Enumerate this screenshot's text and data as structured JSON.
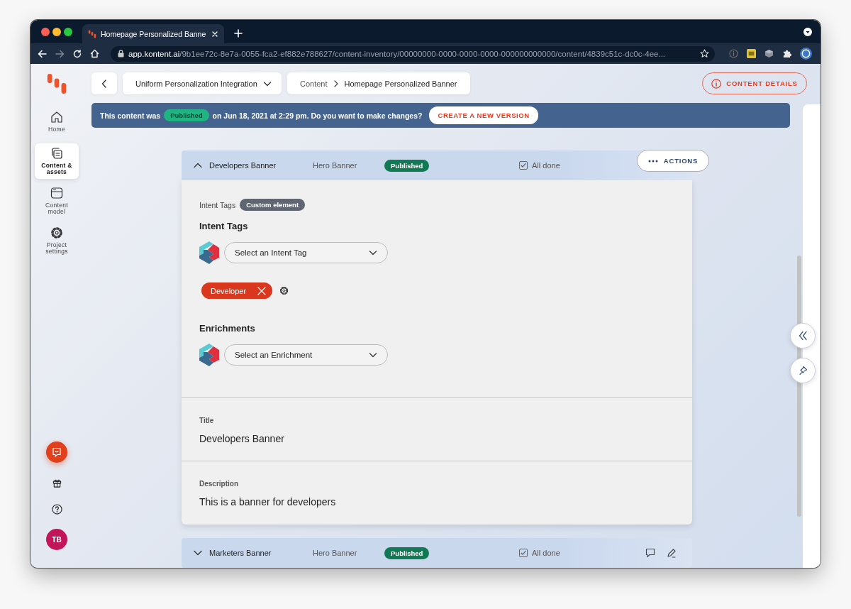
{
  "browser": {
    "tab_title": "Homepage Personalized Banne",
    "url_host": "app.kontent.ai",
    "url_path": "/9b1ee72c-8e7a-0055-fca2-ef882e788627/content-inventory/00000000-0000-0000-0000-000000000000/content/4839c51c-dc0c-4ee..."
  },
  "sidebar": {
    "items": [
      {
        "label": "Home",
        "kind": "home",
        "selected": false
      },
      {
        "label": "Content & assets",
        "kind": "content",
        "selected": true
      },
      {
        "label": "Content model",
        "kind": "model",
        "selected": false
      },
      {
        "label": "Project settings",
        "kind": "settings",
        "selected": false
      }
    ],
    "avatar": "TB"
  },
  "toolbar": {
    "project": "Uniform Personalization Integration",
    "breadcrumb": [
      "Content",
      "Homepage Personalized Banner"
    ],
    "details_button": "CONTENT DETAILS"
  },
  "notice": {
    "text_before": "This content was",
    "status": "Published",
    "text_after": "on Jun 18, 2021 at 2:29 pm. Do you want to make changes?",
    "button": "CREATE A NEW VERSION"
  },
  "items": [
    {
      "name": "Developers Banner",
      "type": "Hero Banner",
      "status": "Published",
      "workflow": "All done",
      "done": true,
      "expanded": true,
      "actions": "ACTIONS",
      "elements": [
        {
          "kind": "custom",
          "label": "Intent Tags",
          "badge": "Custom element",
          "groups": [
            {
              "heading": "Intent Tags",
              "placeholder": "Select an Intent Tag",
              "tags": [
                "Developer"
              ]
            },
            {
              "heading": "Enrichments",
              "placeholder": "Select an Enrichment"
            }
          ]
        },
        {
          "kind": "text",
          "label": "Title",
          "value": "Developers Banner"
        },
        {
          "kind": "text",
          "label": "Description",
          "value": "This is a banner for developers"
        }
      ]
    },
    {
      "name": "Marketers Banner",
      "type": "Hero Banner",
      "status": "Published",
      "workflow": "All done",
      "done": true,
      "expanded": false
    }
  ]
}
